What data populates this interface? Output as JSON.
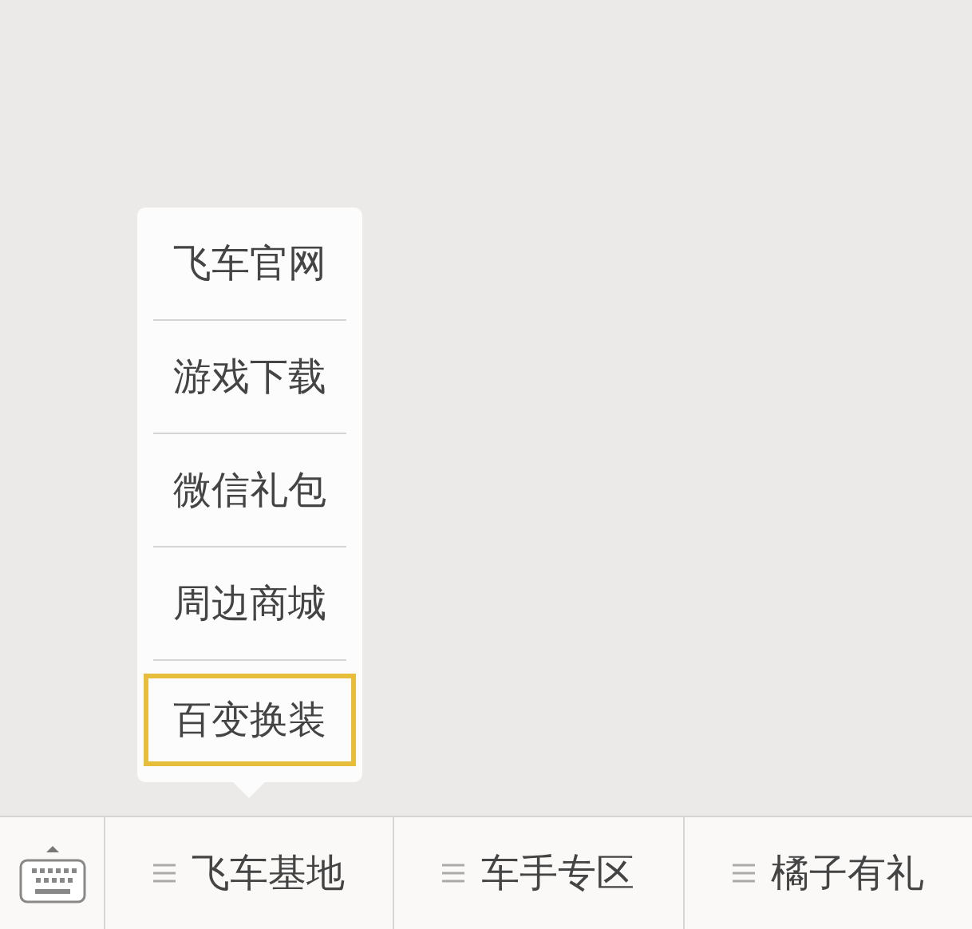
{
  "popup_menu": {
    "items": [
      {
        "label": "飞车官网",
        "selected": false
      },
      {
        "label": "游戏下载",
        "selected": false
      },
      {
        "label": "微信礼包",
        "selected": false
      },
      {
        "label": "周边商城",
        "selected": false
      },
      {
        "label": "百变换装",
        "selected": true
      }
    ]
  },
  "bottom_menu": {
    "items": [
      {
        "label": "飞车基地"
      },
      {
        "label": "车手专区"
      },
      {
        "label": "橘子有礼"
      }
    ]
  }
}
